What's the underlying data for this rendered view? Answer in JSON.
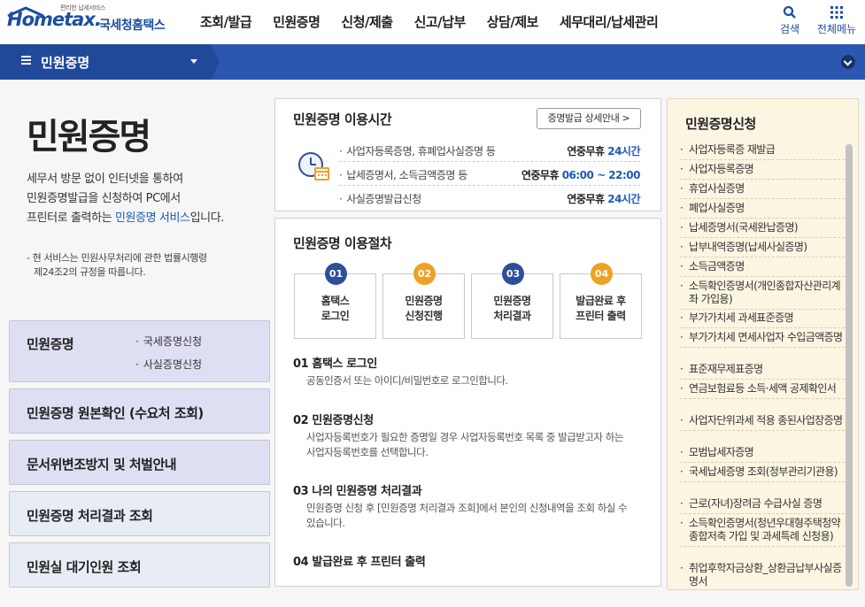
{
  "header": {
    "logo_small": "편리한 납세서비스",
    "logo_main": "Hometax.",
    "logo_sub": "국세청홈택스",
    "gnb": [
      "조회/발급",
      "민원증명",
      "신청/제출",
      "신고/납부",
      "상담/제보",
      "세무대리/납세관리"
    ],
    "search_label": "검색",
    "allmenu_label": "전체메뉴"
  },
  "navbar": {
    "title": "민원증명"
  },
  "intro": {
    "title": "민원증명",
    "line1": "세무서 방문 없이 인터넷을 통하여",
    "line2": "민원증명발급을 신청하여 PC에서",
    "line3_a": "프린터로 출력하는 ",
    "line3_b": "민원증명 서비스",
    "line3_c": "입니다.",
    "note_line1": "- 현 서비스는 민원사무처리에 관한 법률시행령",
    "note_line2": "제24조2의 규정을 따릅니다."
  },
  "left_menu": [
    {
      "label": "민원증명",
      "subs": [
        "국세증명신청",
        "사실증명신청"
      ]
    },
    {
      "label": "민원증명 원본확인 (수요처 조회)"
    },
    {
      "label": "문서위변조방지 및 처벌안내"
    },
    {
      "label": "민원증명 처리결과 조회"
    },
    {
      "label": "민원실 대기인원 조회"
    }
  ],
  "hours": {
    "title": "민원증명 이용시간",
    "detail_button": "증명발급 상세안내 >",
    "rows": [
      {
        "label": "사업자등록증명, 휴폐업사실증명 등",
        "prefix": "연중무휴",
        "value": "24시간"
      },
      {
        "label": "납세증명서, 소득금액증명 등",
        "prefix": "연중무휴",
        "value": "06:00 ~ 22:00"
      },
      {
        "label": "사실증명발급신청",
        "prefix": "연중무휴",
        "value": "24시간"
      }
    ]
  },
  "procedure": {
    "title": "민원증명 이용절차",
    "steps": [
      {
        "num": "01",
        "line1": "홈택스",
        "line2": "로그인"
      },
      {
        "num": "02",
        "line1": "민원증명",
        "line2": "신청진행"
      },
      {
        "num": "03",
        "line1": "민원증명",
        "line2": "처리결과"
      },
      {
        "num": "04",
        "line1": "발급완료 후",
        "line2": "프린터 출력"
      }
    ],
    "details": [
      {
        "head": "01 홈택스 로그인",
        "desc": "공동인증서 또는 아이디/비밀번호로 로그인합니다."
      },
      {
        "head": "02 민원증명신청",
        "desc": "사업자등록번호가 필요한 증명일 경우 사업자등록번호 목록 중 발급받고자 하는 사업자등록번호를 선택합니다."
      },
      {
        "head": "03 나의 민원증명 처리결과",
        "desc": "민원증명 신청 후 [민원증명 처리결과 조회]에서 본인의 신청내역을 조회 하실 수 있습니다."
      },
      {
        "head": "04 발급완료 후 프린터 출력",
        "desc": ""
      }
    ]
  },
  "right_panel": {
    "title": "민원증명신청",
    "items": [
      "사업자등록증 재발급",
      "사업자등록증명",
      "휴업사실증명",
      "폐업사실증명",
      "납세증명서(국세완납증명)",
      "납부내역증명(납세사실증명)",
      "소득금액증명",
      "소득확인증명서(개인종합자산관리계좌 가입용)",
      "부가가치세 과세표준증명",
      "부가가치세 면세사업자 수입금액증명",
      "표준재무제표증명",
      "연금보험료등 소득·세액 공제확인서",
      "사업자단위과세 적용 종된사업장증명",
      "모범납세자증명",
      "국세납세증명 조회(정부관리기관용)",
      "근로(자녀)장려금 수급사실 증명",
      "소득확인증명서(청년우대형주택청약종합저축 가입 및 과세특례 신청용)",
      "취업후학자금상환_상환금납부사실증명서"
    ]
  }
}
